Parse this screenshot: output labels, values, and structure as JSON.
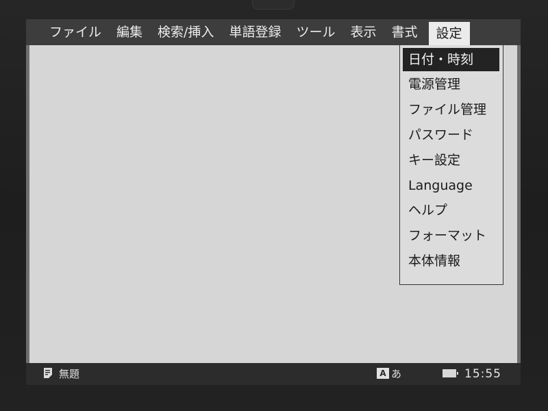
{
  "menubar": {
    "items": [
      {
        "label": "ファイル"
      },
      {
        "label": "編集"
      },
      {
        "label": "検索/挿入"
      },
      {
        "label": "単語登録"
      },
      {
        "label": "ツール"
      },
      {
        "label": "表示"
      },
      {
        "label": "書式"
      },
      {
        "label": "設定"
      }
    ],
    "active": "設定"
  },
  "settings_menu": {
    "items": [
      {
        "label": "日付・時刻"
      },
      {
        "label": "電源管理"
      },
      {
        "label": "ファイル管理"
      },
      {
        "label": "パスワード"
      },
      {
        "label": "キー設定"
      },
      {
        "label": "Language"
      },
      {
        "label": "ヘルプ"
      },
      {
        "label": "フォーマット"
      },
      {
        "label": "本体情報"
      }
    ],
    "selected": "日付・時刻"
  },
  "statusbar": {
    "document_icon": "document-icon",
    "document_title": "無題",
    "ime_mode_box": "A",
    "ime_mode_kana": "あ",
    "battery_icon": "battery-icon",
    "clock": "15:55"
  }
}
